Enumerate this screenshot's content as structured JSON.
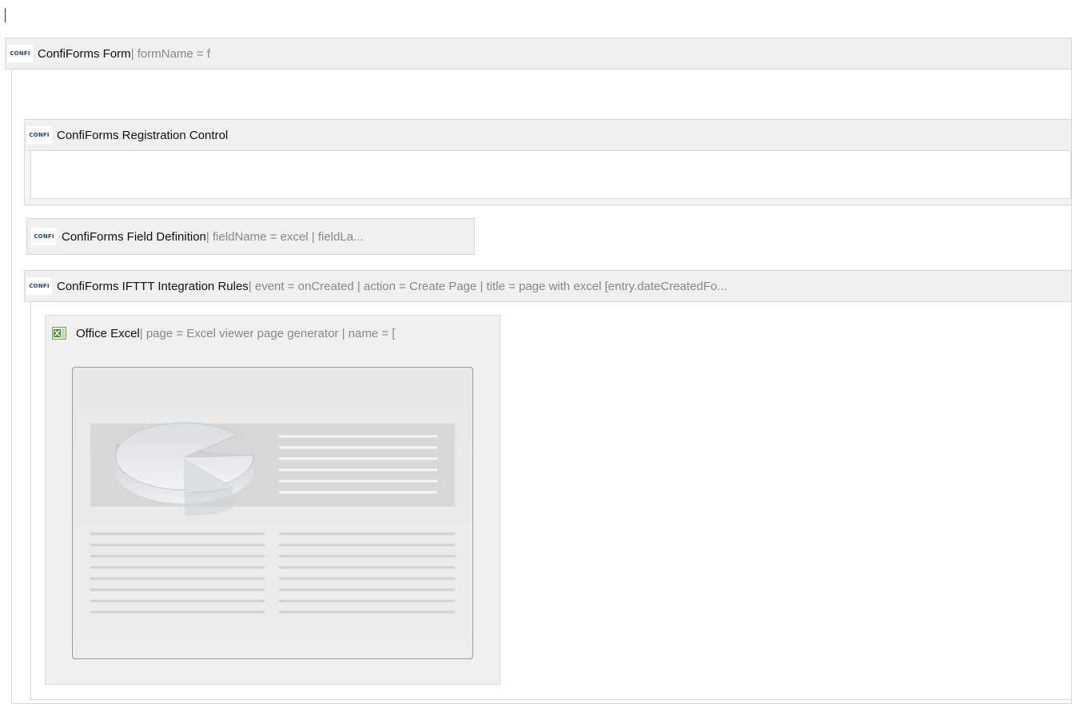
{
  "macros": {
    "form": {
      "icon": "confi-icon",
      "title": "ConfiForms Form",
      "params": " | formName = f"
    },
    "registration": {
      "icon": "confi-icon",
      "title": "ConfiForms Registration Control",
      "params": ""
    },
    "field": {
      "icon": "confi-icon",
      "title": "ConfiForms Field Definition",
      "params": " | fieldName = excel | fieldLa..."
    },
    "ifttt": {
      "icon": "confi-icon",
      "title": "ConfiForms IFTTT Integration Rules",
      "params": " | event = onCreated | action = Create Page | title = page with excel [entry.dateCreatedFo..."
    },
    "excel": {
      "icon": "office-excel-icon",
      "title": "Office Excel",
      "params": " | page = Excel viewer page generator | name = ["
    }
  },
  "icon_text": "CONFI"
}
